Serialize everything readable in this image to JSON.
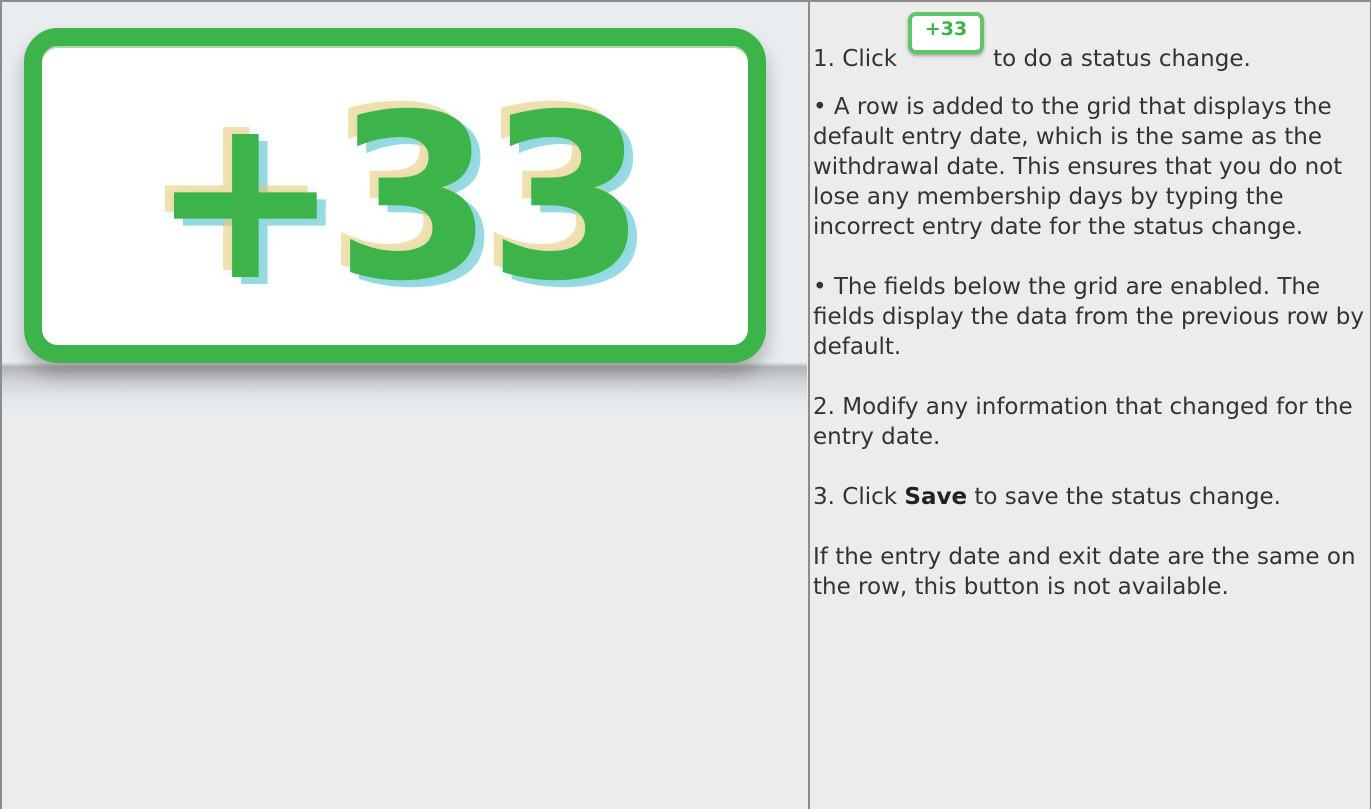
{
  "button_text": "+33",
  "steps": {
    "step1_before": "1. Click",
    "step1_after": "to do a status change.",
    "bullet1": "• A row is added to the grid that displays the default entry date, which is the same as the withdrawal date. This ensures that you do not lose any membership days by typing the incorrect entry date for the status change.",
    "bullet2": "• The fields below the grid are enabled. The fields display the data from the previous row by default.",
    "step2": "2. Modify any information that changed for the entry date.",
    "step3_before": "3. Click",
    "step3_bold": "Save",
    "step3_after": "to save the status change.",
    "note": "If the entry date and exit date are the same on the row, this button is not available."
  },
  "colors": {
    "button_green": "#3cb44a",
    "cell_background": "#ececec",
    "border": "#8c8c8c",
    "text": "#333333"
  }
}
